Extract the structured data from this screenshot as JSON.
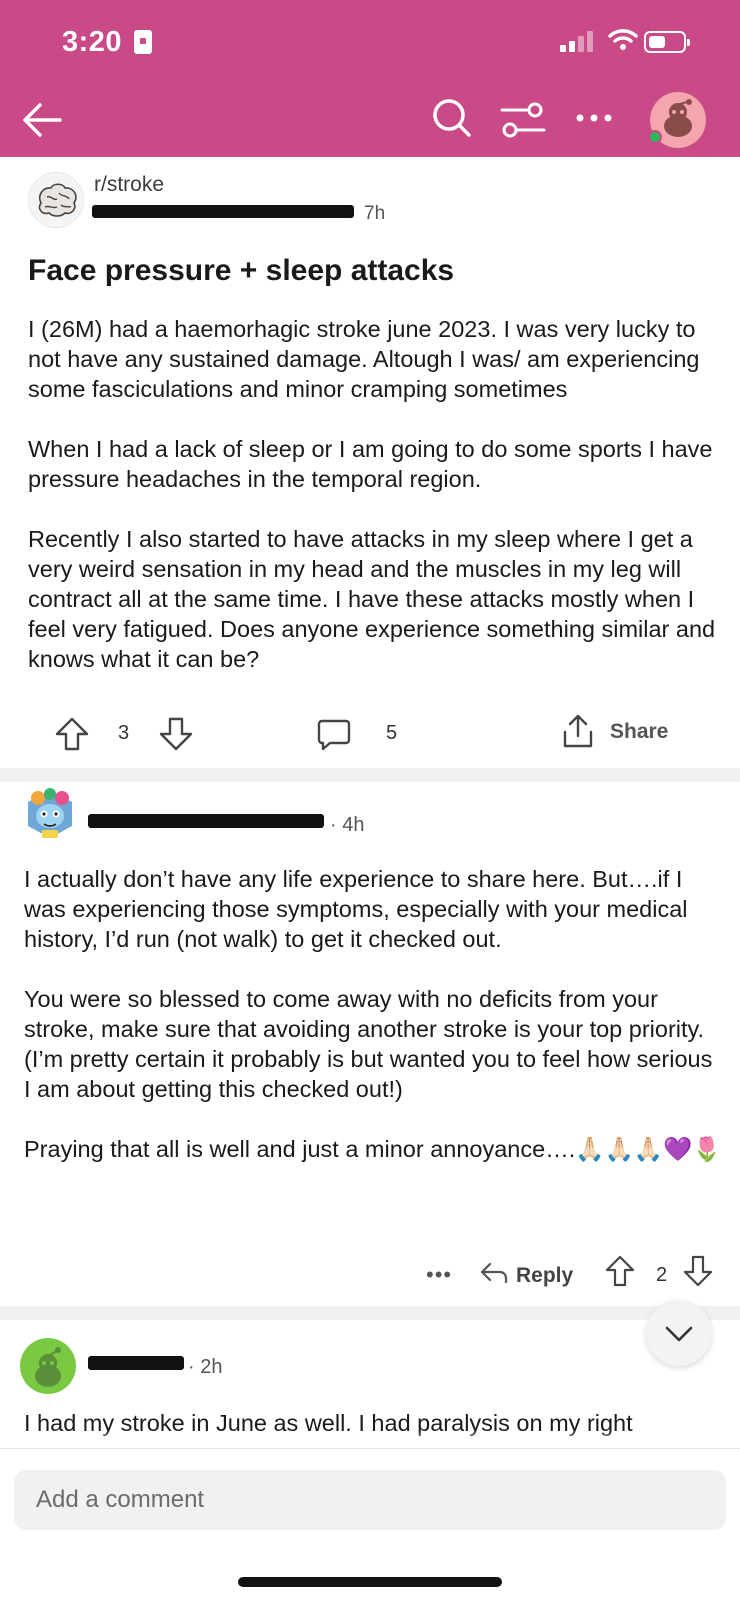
{
  "status_bar": {
    "time": "3:20"
  },
  "colors": {
    "header_bg": "#c94a86",
    "online": "#2bb65a"
  },
  "nav": {
    "back_icon": "back-arrow-icon",
    "search_icon": "search-icon",
    "filter_icon": "sort-filter-icon",
    "more_icon": "more-horizontal-icon",
    "avatar_icon": "user-avatar-icon"
  },
  "post": {
    "subreddit": "r/stroke",
    "time": "7h",
    "title": "Face pressure + sleep attacks",
    "paragraphs": [
      "I (26M) had a haemorhagic stroke june 2023. I was very lucky to not have any sustained damage. Altough I was/ am experiencing some fasciculations and minor cramping sometimes",
      "When I had a lack of sleep or I am going to do some sports I have pressure headaches in the temporal region.",
      "Recently I also started to have attacks in my sleep where I get a very weird sensation in my head and the muscles in my leg will contract all at the same time. I have these attacks mostly when I feel very fatigued. Does anyone experience something similar and knows what it can be?"
    ],
    "votes": "3",
    "comments": "5",
    "share_label": "Share"
  },
  "comments": [
    {
      "time": "· 4h",
      "paragraphs": [
        "I actually don’t have any life experience to share here. But….if I was experiencing those symptoms, especially with your medical history, I’d run (not walk) to get it checked out.",
        "You were so blessed to come away with no deficits from your stroke, make sure that avoiding another stroke is your top priority. (I’m pretty certain it probably is but wanted you to feel how serious I am about getting this checked out!)",
        "Praying that all is well and just a minor annoyance….🙏🏻🙏🏻🙏🏻💜🌷"
      ],
      "more": "•••",
      "reply_label": "Reply",
      "votes": "2"
    },
    {
      "time": "· 2h",
      "paragraphs": [
        "I had my stroke in June as well. I had paralysis on my right"
      ]
    }
  ],
  "comment_bar": {
    "placeholder": "Add a comment"
  }
}
